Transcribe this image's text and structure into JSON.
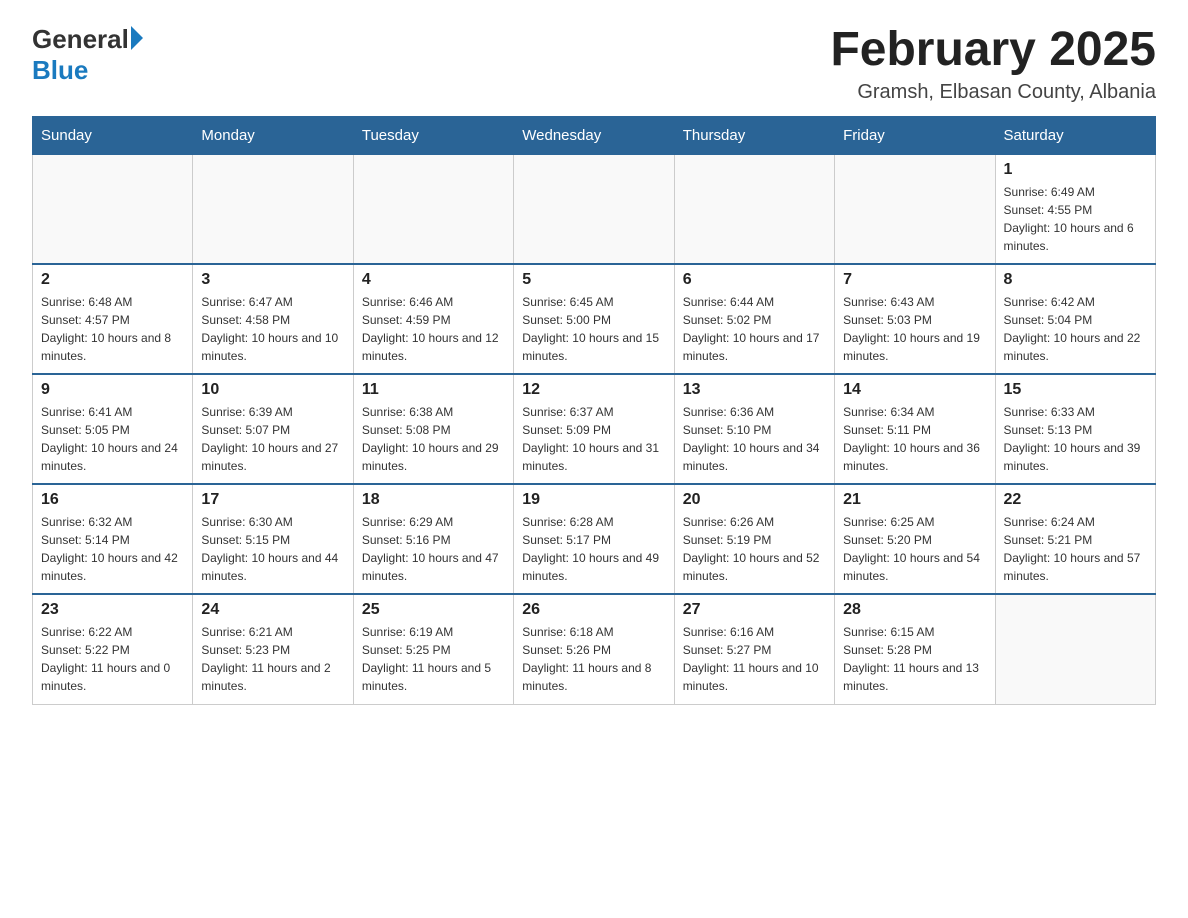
{
  "header": {
    "logo_text_black": "General",
    "logo_text_blue": "Blue",
    "month_title": "February 2025",
    "location": "Gramsh, Elbasan County, Albania"
  },
  "weekdays": [
    "Sunday",
    "Monday",
    "Tuesday",
    "Wednesday",
    "Thursday",
    "Friday",
    "Saturday"
  ],
  "weeks": [
    [
      {
        "day": "",
        "info": ""
      },
      {
        "day": "",
        "info": ""
      },
      {
        "day": "",
        "info": ""
      },
      {
        "day": "",
        "info": ""
      },
      {
        "day": "",
        "info": ""
      },
      {
        "day": "",
        "info": ""
      },
      {
        "day": "1",
        "info": "Sunrise: 6:49 AM\nSunset: 4:55 PM\nDaylight: 10 hours and 6 minutes."
      }
    ],
    [
      {
        "day": "2",
        "info": "Sunrise: 6:48 AM\nSunset: 4:57 PM\nDaylight: 10 hours and 8 minutes."
      },
      {
        "day": "3",
        "info": "Sunrise: 6:47 AM\nSunset: 4:58 PM\nDaylight: 10 hours and 10 minutes."
      },
      {
        "day": "4",
        "info": "Sunrise: 6:46 AM\nSunset: 4:59 PM\nDaylight: 10 hours and 12 minutes."
      },
      {
        "day": "5",
        "info": "Sunrise: 6:45 AM\nSunset: 5:00 PM\nDaylight: 10 hours and 15 minutes."
      },
      {
        "day": "6",
        "info": "Sunrise: 6:44 AM\nSunset: 5:02 PM\nDaylight: 10 hours and 17 minutes."
      },
      {
        "day": "7",
        "info": "Sunrise: 6:43 AM\nSunset: 5:03 PM\nDaylight: 10 hours and 19 minutes."
      },
      {
        "day": "8",
        "info": "Sunrise: 6:42 AM\nSunset: 5:04 PM\nDaylight: 10 hours and 22 minutes."
      }
    ],
    [
      {
        "day": "9",
        "info": "Sunrise: 6:41 AM\nSunset: 5:05 PM\nDaylight: 10 hours and 24 minutes."
      },
      {
        "day": "10",
        "info": "Sunrise: 6:39 AM\nSunset: 5:07 PM\nDaylight: 10 hours and 27 minutes."
      },
      {
        "day": "11",
        "info": "Sunrise: 6:38 AM\nSunset: 5:08 PM\nDaylight: 10 hours and 29 minutes."
      },
      {
        "day": "12",
        "info": "Sunrise: 6:37 AM\nSunset: 5:09 PM\nDaylight: 10 hours and 31 minutes."
      },
      {
        "day": "13",
        "info": "Sunrise: 6:36 AM\nSunset: 5:10 PM\nDaylight: 10 hours and 34 minutes."
      },
      {
        "day": "14",
        "info": "Sunrise: 6:34 AM\nSunset: 5:11 PM\nDaylight: 10 hours and 36 minutes."
      },
      {
        "day": "15",
        "info": "Sunrise: 6:33 AM\nSunset: 5:13 PM\nDaylight: 10 hours and 39 minutes."
      }
    ],
    [
      {
        "day": "16",
        "info": "Sunrise: 6:32 AM\nSunset: 5:14 PM\nDaylight: 10 hours and 42 minutes."
      },
      {
        "day": "17",
        "info": "Sunrise: 6:30 AM\nSunset: 5:15 PM\nDaylight: 10 hours and 44 minutes."
      },
      {
        "day": "18",
        "info": "Sunrise: 6:29 AM\nSunset: 5:16 PM\nDaylight: 10 hours and 47 minutes."
      },
      {
        "day": "19",
        "info": "Sunrise: 6:28 AM\nSunset: 5:17 PM\nDaylight: 10 hours and 49 minutes."
      },
      {
        "day": "20",
        "info": "Sunrise: 6:26 AM\nSunset: 5:19 PM\nDaylight: 10 hours and 52 minutes."
      },
      {
        "day": "21",
        "info": "Sunrise: 6:25 AM\nSunset: 5:20 PM\nDaylight: 10 hours and 54 minutes."
      },
      {
        "day": "22",
        "info": "Sunrise: 6:24 AM\nSunset: 5:21 PM\nDaylight: 10 hours and 57 minutes."
      }
    ],
    [
      {
        "day": "23",
        "info": "Sunrise: 6:22 AM\nSunset: 5:22 PM\nDaylight: 11 hours and 0 minutes."
      },
      {
        "day": "24",
        "info": "Sunrise: 6:21 AM\nSunset: 5:23 PM\nDaylight: 11 hours and 2 minutes."
      },
      {
        "day": "25",
        "info": "Sunrise: 6:19 AM\nSunset: 5:25 PM\nDaylight: 11 hours and 5 minutes."
      },
      {
        "day": "26",
        "info": "Sunrise: 6:18 AM\nSunset: 5:26 PM\nDaylight: 11 hours and 8 minutes."
      },
      {
        "day": "27",
        "info": "Sunrise: 6:16 AM\nSunset: 5:27 PM\nDaylight: 11 hours and 10 minutes."
      },
      {
        "day": "28",
        "info": "Sunrise: 6:15 AM\nSunset: 5:28 PM\nDaylight: 11 hours and 13 minutes."
      },
      {
        "day": "",
        "info": ""
      }
    ]
  ]
}
